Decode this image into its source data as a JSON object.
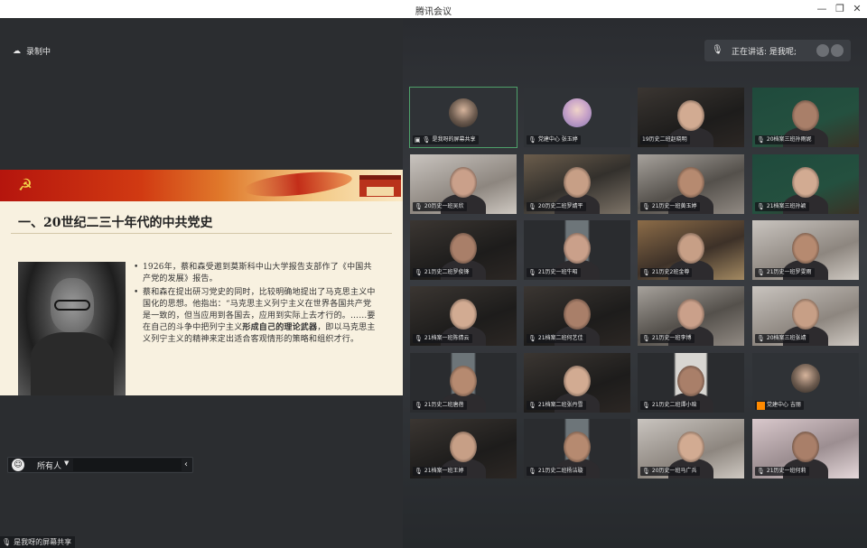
{
  "window": {
    "title": "腾讯会议",
    "minimize_icon": "minimize-icon",
    "restore_icon": "restore-icon",
    "close_icon": "close-icon"
  },
  "recording": {
    "icon": "cloud-icon",
    "label": "录制中"
  },
  "slide": {
    "heading": "一、20世纪二三十年代的中共党史",
    "bullets": [
      {
        "text": "1926年，蔡和森受邀到莫斯科中山大学报告支部作了《中国共产党的发展》报告。"
      },
      {
        "text_before": "蔡和森在提出研习党史的同时，比较明确地提出了马克思主义中国化的思想。他指出：“马克思主义列宁主义在世界各国共产党是一致的，但当应用到各国去，应用到实际上去才行的。……要在自己的斗争中把列宁主义",
        "text_bold": "形成自己的理论武器",
        "text_after": "，即以马克思主义列宁主义的精神来定出适合客观情形的策略和组织才行。"
      }
    ]
  },
  "chat": {
    "emoji_icon": "smile-icon",
    "recipient": "所有人",
    "input_value": "",
    "collapse_icon": "chevron-left-icon"
  },
  "share_pill": {
    "icon": "mic-icon",
    "label": "是我呀的屏幕共享"
  },
  "speaking": {
    "icon": "mic-icon",
    "label": "正在讲话: 是我呢;"
  },
  "tiles": [
    {
      "label": "是我呀的屏幕共享",
      "icons": [
        "screen-share-icon",
        "mic-icon"
      ],
      "style": "avatar-dark",
      "active": true
    },
    {
      "label": "党建中心 张玉婷",
      "icons": [
        "mic-icon"
      ],
      "style": "avatar-purple"
    },
    {
      "label": "19历史二班赵晓明",
      "icons": [],
      "style": "cam-dark"
    },
    {
      "label": "20档案三班孙雨妮",
      "icons": [
        "mic-icon"
      ],
      "style": "cam-green"
    },
    {
      "label": "20历史一班吴欣",
      "icons": [
        "mic-icon"
      ],
      "style": "cam-light"
    },
    {
      "label": "20历史二班罗婧平",
      "icons": [
        "mic-icon"
      ],
      "style": "cam-shelf"
    },
    {
      "label": "21历史一班黄玉婷",
      "icons": [
        "mic-icon"
      ],
      "style": "cam-room"
    },
    {
      "label": "21档案三班孙颖",
      "icons": [
        "mic-icon"
      ],
      "style": "cam-green"
    },
    {
      "label": "21历史二班罗俊锋",
      "icons": [
        "mic-icon"
      ],
      "style": "cam-dark"
    },
    {
      "label": "21历史一班牛昭",
      "icons": [
        "mic-icon"
      ],
      "style": "cam-portrait"
    },
    {
      "label": "21历史2班金尊",
      "icons": [
        "mic-icon"
      ],
      "style": "cam-warm"
    },
    {
      "label": "21历史一班罗雯雨",
      "icons": [
        "mic-icon"
      ],
      "style": "cam-light"
    },
    {
      "label": "21档案一班陈倩云",
      "icons": [
        "mic-icon"
      ],
      "style": "cam-dark"
    },
    {
      "label": "21档案二班何艺佳",
      "icons": [
        "mic-icon"
      ],
      "style": "cam-dark"
    },
    {
      "label": "21历史一班李博",
      "icons": [
        "mic-icon"
      ],
      "style": "cam-room"
    },
    {
      "label": "20档案三班张靖",
      "icons": [
        "mic-icon"
      ],
      "style": "cam-light"
    },
    {
      "label": "21历史二班唐蓓",
      "icons": [
        "mic-icon"
      ],
      "style": "cam-portrait"
    },
    {
      "label": "21档案二班张丹雪",
      "icons": [
        "mic-icon"
      ],
      "style": "cam-dark"
    },
    {
      "label": "21历史二班谭小晗",
      "icons": [
        "mic-icon"
      ],
      "style": "cam-portrait-light"
    },
    {
      "label": "党建中心 吉丽",
      "icons": [
        "org-icon"
      ],
      "style": "avatar-dark"
    },
    {
      "label": "21档案一班王婷",
      "icons": [
        "mic-icon"
      ],
      "style": "cam-dark"
    },
    {
      "label": "21历史二班杨洁璇",
      "icons": [
        "mic-icon"
      ],
      "style": "cam-portrait"
    },
    {
      "label": "20历史一班马广兵",
      "icons": [
        "mic-icon"
      ],
      "style": "cam-light"
    },
    {
      "label": "21历史一班何莉",
      "icons": [
        "mic-icon"
      ],
      "style": "cam-pink"
    }
  ]
}
